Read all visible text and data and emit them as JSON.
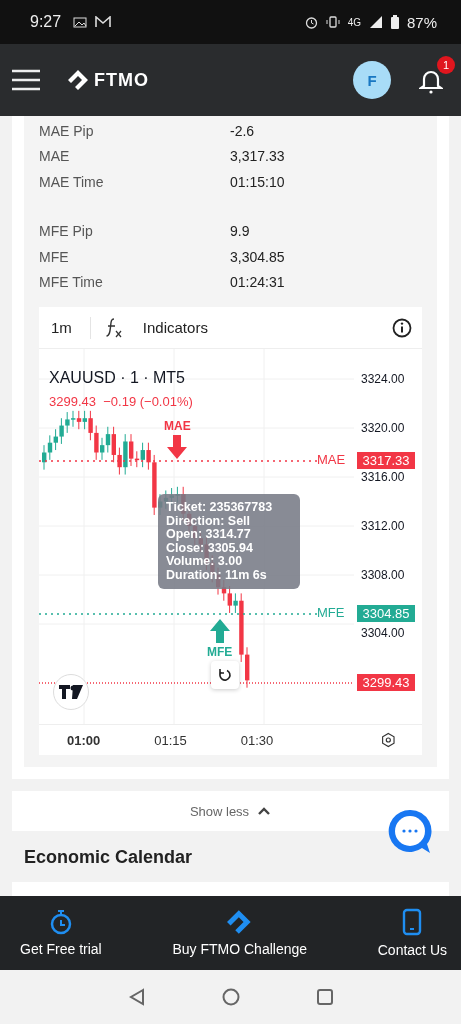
{
  "status_bar": {
    "time": "9:27",
    "network": "4G",
    "battery": "87%"
  },
  "header": {
    "logo": "FTMO",
    "avatar": "F",
    "notification_count": "1"
  },
  "metric_groups": [
    [
      {
        "label": "MAE Pip",
        "value": "-2.6"
      },
      {
        "label": "MAE",
        "value": "3,317.33"
      },
      {
        "label": "MAE Time",
        "value": "01:15:10"
      }
    ],
    [
      {
        "label": "MFE Pip",
        "value": "9.9"
      },
      {
        "label": "MFE",
        "value": "3,304.85"
      },
      {
        "label": "MFE Time",
        "value": "01:24:31"
      }
    ]
  ],
  "chart": {
    "interval": "1m",
    "indicators": "Indicators",
    "symbol": "XAUUSD · 1 · MT5",
    "quote": "3299.43  −0.19 (−0.01%)",
    "price_ticks": [
      "3324.00",
      "3320.00",
      "3316.00",
      "3312.00",
      "3308.00",
      "3304.00"
    ],
    "time_ticks": [
      {
        "label": "01:00",
        "bold": true
      },
      {
        "label": "01:15",
        "bold": false
      },
      {
        "label": "01:30",
        "bold": false
      }
    ],
    "lines": [
      {
        "kind": "mae",
        "label": "MAE",
        "price": "3317.33"
      },
      {
        "kind": "mfe",
        "label": "MFE",
        "price": "3304.85"
      },
      {
        "kind": "current",
        "price": "3299.43"
      }
    ],
    "markers": [
      {
        "kind": "mae",
        "label": "MAE"
      },
      {
        "kind": "mfe",
        "label": "MFE"
      }
    ],
    "tooltip": [
      "Ticket: 235367783",
      "Direction: Sell",
      "Open: 3314.77",
      "Close: 3305.94",
      "Volume: 3.00",
      "Duration: 11m 6s"
    ]
  },
  "show_less": "Show less",
  "section_title": "Economic Calendar",
  "bottom_nav": [
    {
      "kind": "timer",
      "label": "Get Free trial"
    },
    {
      "kind": "logo",
      "label": "Buy FTMO Challenge"
    },
    {
      "kind": "phone",
      "label": "Contact Us"
    }
  ]
}
